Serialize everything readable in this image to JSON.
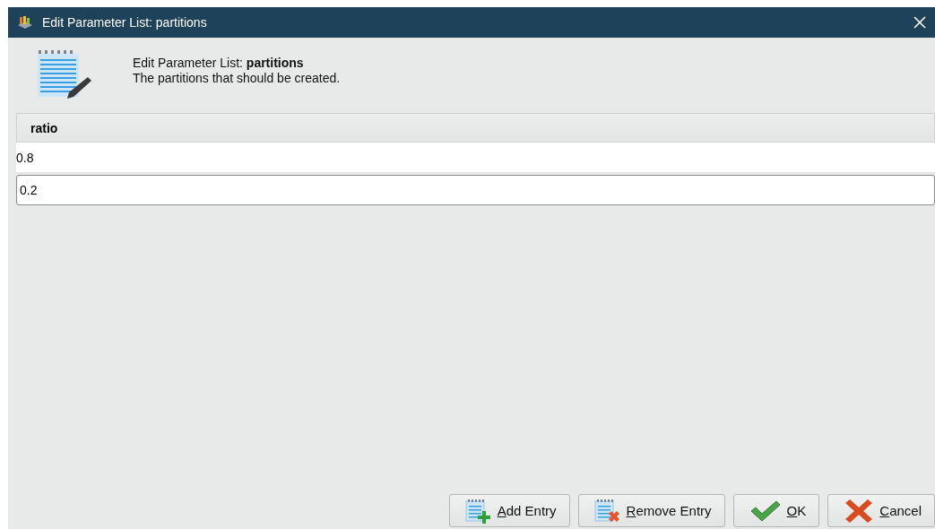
{
  "window": {
    "title": "Edit Parameter List: partitions"
  },
  "header": {
    "title": "Edit Parameter List: **partitions**",
    "description": "The partitions that should be created."
  },
  "table": {
    "columns": [
      "ratio"
    ],
    "rows": [
      {
        "value": "0.8",
        "selected": false
      },
      {
        "value": "0.2",
        "selected": true
      }
    ]
  },
  "buttons": [
    {
      "kind": "add",
      "label": "Add Entry"
    },
    {
      "kind": "remove",
      "label": "Remove Entry"
    },
    {
      "kind": "ok",
      "label": "OK"
    },
    {
      "kind": "cancel",
      "label": "Cancel"
    }
  ]
}
